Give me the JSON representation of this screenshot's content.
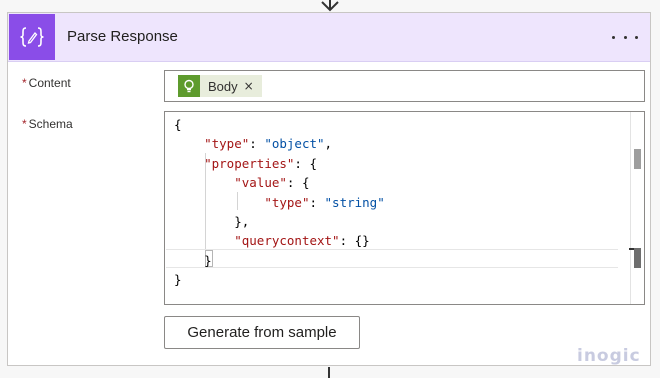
{
  "card": {
    "title": "Parse Response",
    "icon": "curly-braces-edit-icon",
    "more_icon": "ellipsis-icon",
    "colors": {
      "header_bg": "#eee5fd",
      "icon_bg": "#8a4de8"
    }
  },
  "fields": {
    "content": {
      "required_mark": "*",
      "label": "Content",
      "token": {
        "label": "Body",
        "icon": "lightbulb-icon",
        "close": "×",
        "color": "#5e9b2d"
      }
    },
    "schema": {
      "required_mark": "*",
      "label": "Schema"
    }
  },
  "schema_code": {
    "lines": [
      {
        "indent": "",
        "parts": [
          {
            "t": "{",
            "c": "p"
          }
        ]
      },
      {
        "indent": "    ",
        "parts": [
          {
            "t": "\"type\"",
            "c": "k"
          },
          {
            "t": ": ",
            "c": "p"
          },
          {
            "t": "\"object\"",
            "c": "s"
          },
          {
            "t": ",",
            "c": "p"
          }
        ]
      },
      {
        "indent": "    ",
        "parts": [
          {
            "t": "\"properties\"",
            "c": "k"
          },
          {
            "t": ": {",
            "c": "p"
          }
        ]
      },
      {
        "indent": "        ",
        "parts": [
          {
            "t": "\"value\"",
            "c": "k"
          },
          {
            "t": ": {",
            "c": "p"
          }
        ]
      },
      {
        "indent": "            ",
        "parts": [
          {
            "t": "\"type\"",
            "c": "k"
          },
          {
            "t": ": ",
            "c": "p"
          },
          {
            "t": "\"string\"",
            "c": "s"
          }
        ]
      },
      {
        "indent": "        ",
        "parts": [
          {
            "t": "},",
            "c": "p"
          }
        ]
      },
      {
        "indent": "        ",
        "parts": [
          {
            "t": "\"querycontext\"",
            "c": "k"
          },
          {
            "t": ": {}",
            "c": "p"
          }
        ]
      },
      {
        "indent": "    ",
        "parts": [
          {
            "t": "}",
            "c": "p"
          }
        ]
      },
      {
        "indent": "",
        "parts": [
          {
            "t": "}",
            "c": "p"
          }
        ]
      }
    ]
  },
  "buttons": {
    "generate": "Generate from sample"
  },
  "watermark": "inogic"
}
